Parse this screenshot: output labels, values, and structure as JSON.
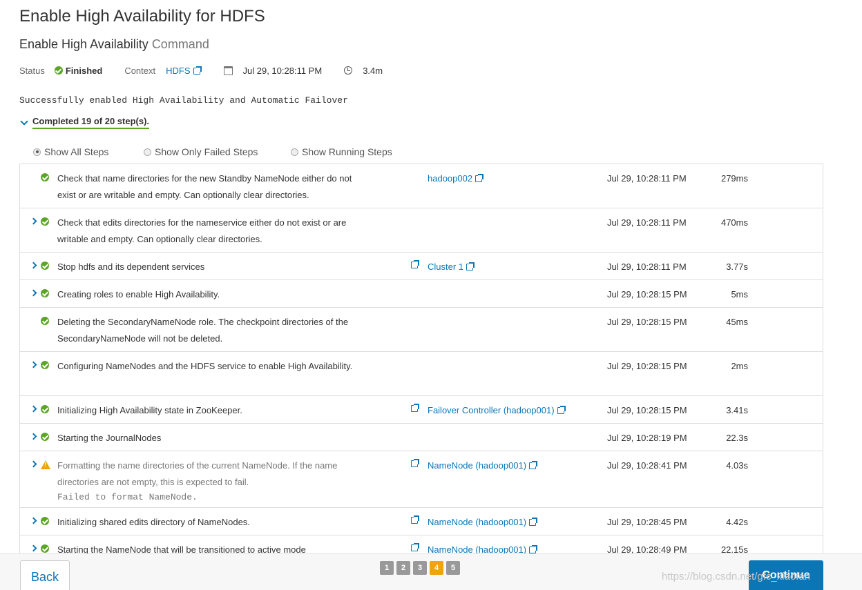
{
  "page_title": "Enable High Availability for HDFS",
  "subtitle": {
    "main": "Enable High Availability",
    "muted": "Command"
  },
  "meta": {
    "status_label": "Status",
    "status_value": "Finished",
    "context_label": "Context",
    "context_value": "HDFS",
    "started": "Jul 29, 10:28:11 PM",
    "duration": "3.4m"
  },
  "message": "Successfully enabled High Availability and Automatic Failover",
  "completed": "Completed 19 of 20 step(s).",
  "filters": [
    "Show All Steps",
    "Show Only Failed Steps",
    "Show Running Steps"
  ],
  "steps": [
    {
      "desc": "Check that name directories for the new Standby NameNode either do not exist or are writable and empty. Can optionally clear directories.",
      "host": "hadoop002",
      "time": "Jul 29, 10:28:11 PM",
      "duration": "279ms"
    },
    {
      "desc": "Check that edits directories for the nameservice either do not exist or are writable and empty. Can optionally clear directories.",
      "host": "",
      "time": "Jul 29, 10:28:11 PM",
      "duration": "470ms"
    },
    {
      "desc": "Stop hdfs and its dependent services",
      "host": "Cluster 1",
      "time": "Jul 29, 10:28:11 PM",
      "duration": "3.77s"
    },
    {
      "desc": "Creating roles to enable High Availability.",
      "host": "",
      "time": "Jul 29, 10:28:15 PM",
      "duration": "5ms"
    },
    {
      "desc": "Deleting the SecondaryNameNode role. The checkpoint directories of the SecondaryNameNode will not be deleted.",
      "host": "",
      "time": "Jul 29, 10:28:15 PM",
      "duration": "45ms"
    },
    {
      "desc": "Configuring NameNodes and the HDFS service to enable High Availability.",
      "host": "",
      "time": "Jul 29, 10:28:15 PM",
      "duration": "2ms"
    },
    {
      "desc": "Initializing High Availability state in ZooKeeper.",
      "host": "Failover Controller (hadoop001)",
      "time": "Jul 29, 10:28:15 PM",
      "duration": "3.41s"
    },
    {
      "desc": "Starting the JournalNodes",
      "host": "",
      "time": "Jul 29, 10:28:19 PM",
      "duration": "22.3s"
    },
    {
      "desc": "Formatting the name directories of the current NameNode. If the name directories are not empty, this is expected to fail.",
      "sub": "Failed to format NameNode.",
      "host": "NameNode (hadoop001)",
      "time": "Jul 29, 10:28:41 PM",
      "duration": "4.03s"
    },
    {
      "desc": "Initializing shared edits directory of NameNodes.",
      "host": "NameNode (hadoop001)",
      "time": "Jul 29, 10:28:45 PM",
      "duration": "4.42s"
    },
    {
      "desc": "Starting the NameNode that will be transitioned to active mode",
      "host": "NameNode (hadoop001)",
      "time": "Jul 29, 10:28:49 PM",
      "duration": "22.15s"
    }
  ],
  "footer": {
    "back": "Back",
    "continue": "Continue",
    "pages": [
      "1",
      "2",
      "3",
      "4",
      "5"
    ],
    "watermark": "https://blog.csdn.net/gfc_xiaofan"
  },
  "colors": {
    "accent": "#0b76b6",
    "success": "#5ba525",
    "warning": "#f0a30a"
  }
}
